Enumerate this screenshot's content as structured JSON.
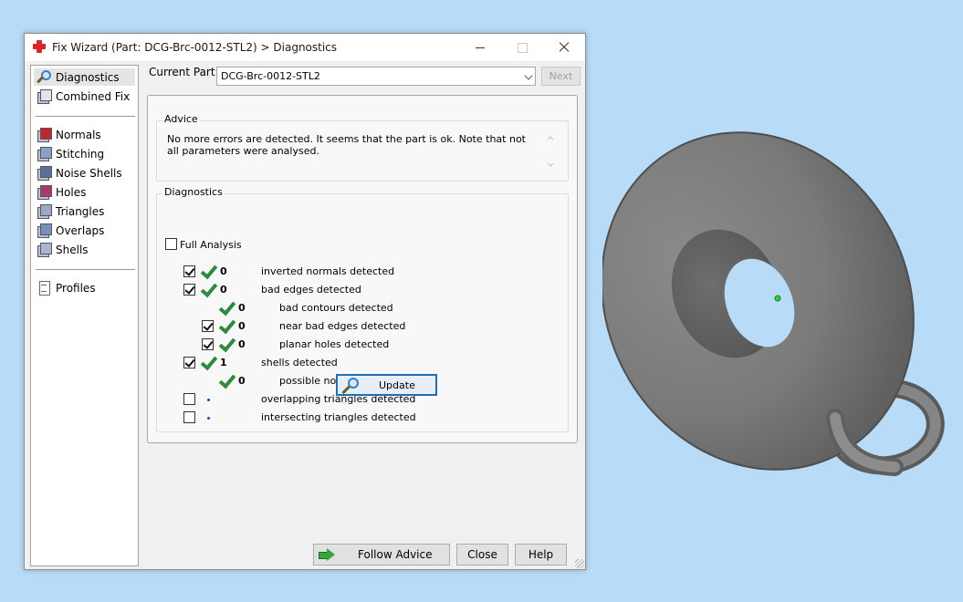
{
  "window": {
    "title": "Fix Wizard (Part: DCG-Brc-0012-STL2) > Diagnostics"
  },
  "nav": {
    "items": [
      {
        "label": "Diagnostics",
        "icon": "magnifier-icon",
        "selected": true
      },
      {
        "label": "Combined Fix",
        "icon": "cube-icon"
      },
      {
        "label": "Normals",
        "icon": "normals-cube-icon"
      },
      {
        "label": "Stitching",
        "icon": "stitching-cube-icon"
      },
      {
        "label": "Noise Shells",
        "icon": "noise-shells-cube-icon"
      },
      {
        "label": "Holes",
        "icon": "holes-cube-icon"
      },
      {
        "label": "Triangles",
        "icon": "triangles-cube-icon"
      },
      {
        "label": "Overlaps",
        "icon": "overlaps-cube-icon"
      },
      {
        "label": "Shells",
        "icon": "shells-cube-icon"
      },
      {
        "label": "Profiles",
        "icon": "document-icon"
      }
    ]
  },
  "part": {
    "label": "Current Part:",
    "value": "DCG-Brc-0012-STL2",
    "next_label": "Next"
  },
  "advice": {
    "title": "Advice",
    "text": "No more errors are detected. It seems that the part is ok. Note that not all parameters were analysed."
  },
  "diagnostics": {
    "title": "Diagnostics",
    "full_analysis_label": "Full Analysis",
    "full_analysis_checked": false,
    "rows": [
      {
        "checked": true,
        "status": "ok",
        "count": "0",
        "label": "inverted normals detected"
      },
      {
        "checked": true,
        "status": "ok",
        "count": "0",
        "label": "bad edges detected"
      },
      {
        "checked": null,
        "status": "ok",
        "count": "0",
        "label": "bad contours detected"
      },
      {
        "checked": true,
        "status": "ok",
        "count": "0",
        "label": "near bad edges detected"
      },
      {
        "checked": true,
        "status": "ok",
        "count": "0",
        "label": "planar holes detected"
      },
      {
        "checked": true,
        "status": "ok",
        "count": "1",
        "label": "shells detected"
      },
      {
        "checked": null,
        "status": "ok",
        "count": "0",
        "label": "possible noise shells detected"
      },
      {
        "checked": false,
        "status": "none",
        "count": "",
        "label": "overlapping triangles detected"
      },
      {
        "checked": false,
        "status": "none",
        "count": "",
        "label": "intersecting triangles detected"
      }
    ],
    "update_label": "Update"
  },
  "footer": {
    "follow_label": "Follow Advice",
    "close_label": "Close",
    "help_label": "Help"
  },
  "colors": {
    "desktop": "#b8dcf8",
    "check_green": "#2e8b3e",
    "accent_blue": "#1f6fb5",
    "model_gray": "#7c7c7c"
  }
}
